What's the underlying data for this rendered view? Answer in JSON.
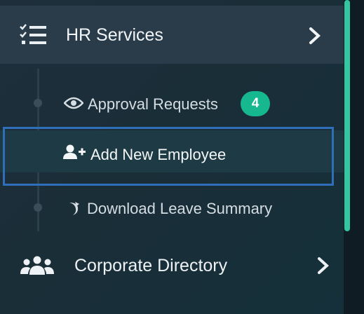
{
  "sidebar": {
    "hr_services": {
      "label": "HR Services",
      "icon": "list-check-icon"
    },
    "sub_items": [
      {
        "label": "Approval Requests",
        "icon": "eye-icon",
        "badge": "4"
      },
      {
        "label": "Add New Employee",
        "icon": "user-plus-icon"
      },
      {
        "label": "Download Leave Summary",
        "icon": "download-leave-icon"
      }
    ],
    "corporate_directory": {
      "label": "Corporate Directory",
      "icon": "users-group-icon"
    }
  },
  "colors": {
    "accent": "#16b890",
    "scrollbar": "#33c6a3",
    "highlight": "#2f6fba",
    "background": "#1a2e38"
  }
}
